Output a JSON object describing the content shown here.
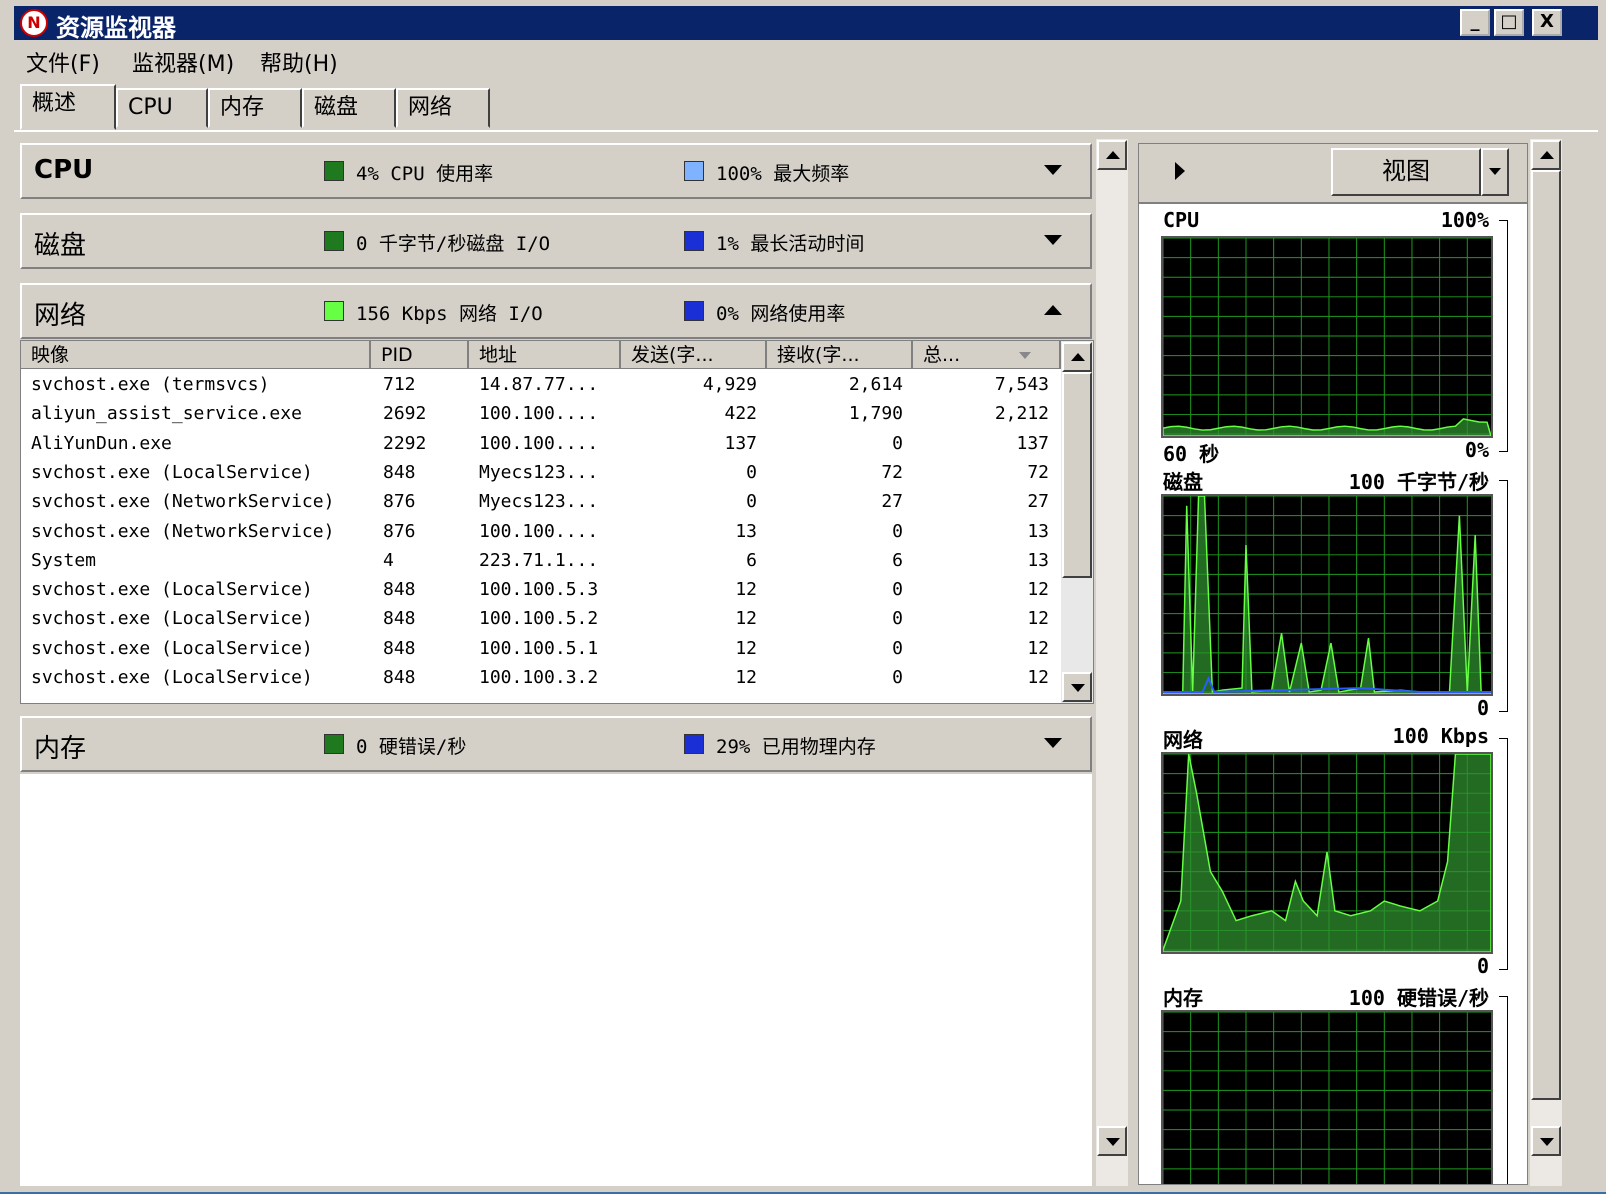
{
  "window": {
    "title": "资源监视器",
    "app_icon": "resmon-icon",
    "controls": [
      "_",
      "□",
      "X"
    ]
  },
  "menu": {
    "items": [
      "文件(F)",
      "监视器(M)",
      "帮助(H)"
    ]
  },
  "tabs": [
    "概述",
    "CPU",
    "内存",
    "磁盘",
    "网络"
  ],
  "active_tab": "概述",
  "sections": {
    "cpu": {
      "title": "CPU",
      "stat1": "4% CPU 使用率",
      "stat1_color": "#1f7a1f",
      "stat2": "100% 最大频率",
      "stat2_color": "#7fb2ff",
      "expanded": false
    },
    "disk": {
      "title": "磁盘",
      "stat1": "0 千字节/秒磁盘 I/O",
      "stat1_color": "#1f7a1f",
      "stat2": "1% 最长活动时间",
      "stat2_color": "#1a2fd6",
      "expanded": false
    },
    "network": {
      "title": "网络",
      "stat1": "156 Kbps 网络 I/O",
      "stat1_color": "#66ff44",
      "stat2": "0% 网络使用率",
      "stat2_color": "#1a2fd6",
      "expanded": true
    },
    "memory": {
      "title": "内存",
      "stat1": "0 硬错误/秒",
      "stat1_color": "#1f7a1f",
      "stat2": "29% 已用物理内存",
      "stat2_color": "#1a2fd6",
      "expanded": false
    }
  },
  "network_table": {
    "columns": [
      "映像",
      "PID",
      "地址",
      "发送(字...",
      "接收(字...",
      "总..."
    ],
    "sort_indicator_icon": "sort-down-icon",
    "rows": [
      [
        "svchost.exe (termsvcs)",
        "712",
        "14.87.77...",
        "4,929",
        "2,614",
        "7,543"
      ],
      [
        "aliyun_assist_service.exe",
        "2692",
        "100.100....",
        "422",
        "1,790",
        "2,212"
      ],
      [
        "AliYunDun.exe",
        "2292",
        "100.100....",
        "137",
        "0",
        "137"
      ],
      [
        "svchost.exe (LocalService)",
        "848",
        "Myecs123...",
        "0",
        "72",
        "72"
      ],
      [
        "svchost.exe (NetworkService)",
        "876",
        "Myecs123...",
        "0",
        "27",
        "27"
      ],
      [
        "svchost.exe (NetworkService)",
        "876",
        "100.100....",
        "13",
        "0",
        "13"
      ],
      [
        "System",
        "4",
        "223.71.1...",
        "6",
        "6",
        "13"
      ],
      [
        "svchost.exe (LocalService)",
        "848",
        "100.100.5.3",
        "12",
        "0",
        "12"
      ],
      [
        "svchost.exe (LocalService)",
        "848",
        "100.100.5.2",
        "12",
        "0",
        "12"
      ],
      [
        "svchost.exe (LocalService)",
        "848",
        "100.100.5.1",
        "12",
        "0",
        "12"
      ],
      [
        "svchost.exe (LocalService)",
        "848",
        "100.100.3.2",
        "12",
        "0",
        "12"
      ]
    ]
  },
  "right_pane": {
    "view_button": "视图",
    "graphs": [
      {
        "name": "CPU",
        "max_label": "100%",
        "bottom_left": "60 秒",
        "bottom_right": "0%"
      },
      {
        "name": "磁盘",
        "max_label": "100 千字节/秒",
        "bottom_left": "",
        "bottom_right": "0"
      },
      {
        "name": "网络",
        "max_label": "100 Kbps",
        "bottom_left": "",
        "bottom_right": "0"
      },
      {
        "name": "内存",
        "max_label": "100 硬错误/秒",
        "bottom_left": "",
        "bottom_right": ""
      }
    ],
    "grid_color": "#1f9a1f",
    "line_color": "#66ff44",
    "fill_color": "#2f8f2f",
    "secondary_line_color": "#2a5cff"
  }
}
